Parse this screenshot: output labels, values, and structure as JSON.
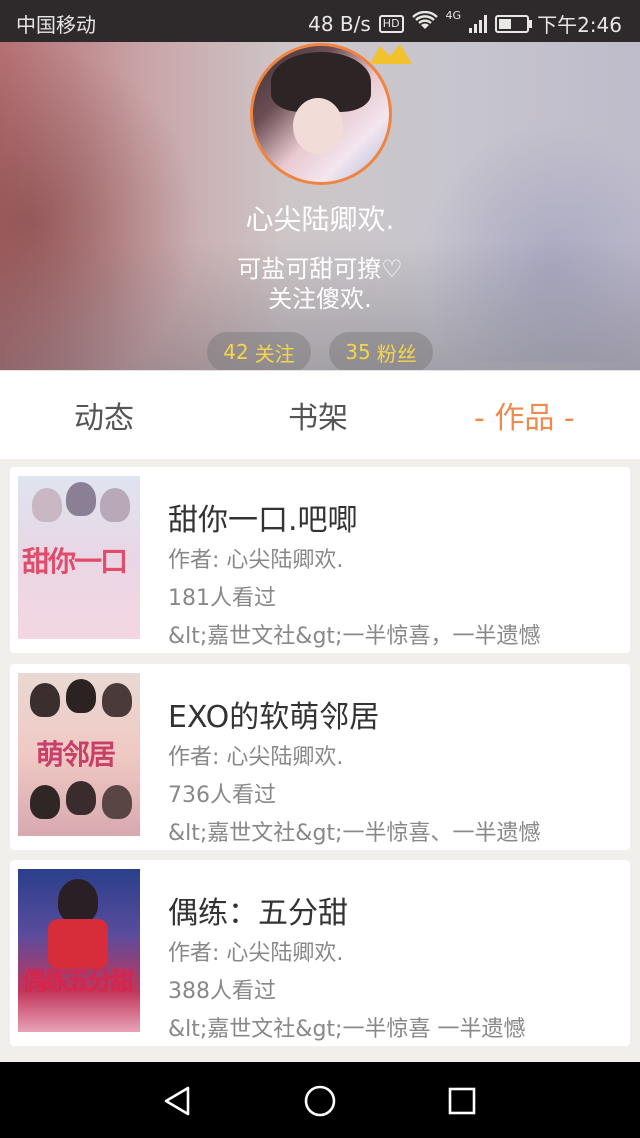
{
  "status_bar": {
    "carrier": "中国移动",
    "speed": "48 B/s",
    "hd": "HD",
    "network": "4G",
    "time": "下午2:46"
  },
  "profile": {
    "username": "心尖陆卿欢.",
    "bio_line1": "可盐可甜可撩♡",
    "bio_line2": "关注傻欢.",
    "follow_count": "42",
    "follow_label": "关注",
    "fans_count": "35",
    "fans_label": "粉丝"
  },
  "tabs": [
    {
      "label": "动态",
      "active": false
    },
    {
      "label": "书架",
      "active": false
    },
    {
      "label": "- 作品 -",
      "active": true
    }
  ],
  "books": [
    {
      "title": "甜你一口.吧唧",
      "author": "作者: 心尖陆卿欢.",
      "views": "181人看过",
      "desc": "&lt;嘉世文社&gt;一半惊喜，一半遗憾",
      "cover_text": "甜你一口"
    },
    {
      "title": "EXO的软萌邻居",
      "author": "作者: 心尖陆卿欢.",
      "views": "736人看过",
      "desc": "&lt;嘉世文社&gt;一半惊喜、一半遗憾",
      "cover_text": "萌邻居"
    },
    {
      "title": "偶练：五分甜",
      "author": "作者: 心尖陆卿欢.",
      "views": "388人看过",
      "desc": "&lt;嘉世文社&gt;一半惊喜 一半遗憾",
      "cover_text": "偶练五分甜"
    }
  ],
  "colors": {
    "accent": "#ef8a4e",
    "pill_text": "#f6d54a",
    "avatar_border": "#f0843e"
  },
  "icons": {
    "back": "back-triangle-icon",
    "home": "home-circle-icon",
    "recents": "recents-square-icon"
  }
}
